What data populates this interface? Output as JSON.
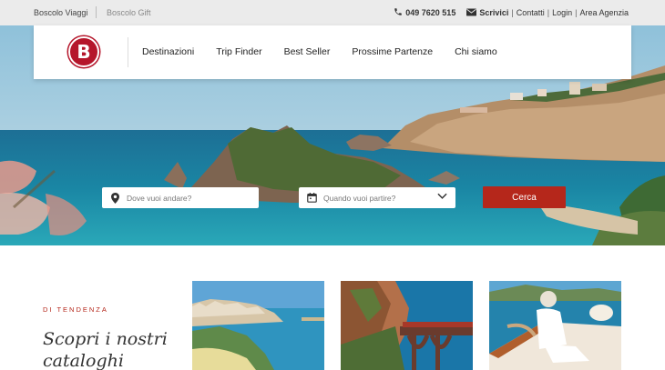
{
  "topbar": {
    "link1": "Boscolo Viaggi",
    "link2": "Boscolo Gift",
    "phone": "049 7620 515",
    "write": "Scrivici",
    "contacts": "Contatti",
    "login": "Login",
    "agency": "Area Agenzia",
    "pipe": "|"
  },
  "logo": {
    "letter": "B"
  },
  "nav": {
    "items": [
      "Destinazioni",
      "Trip Finder",
      "Best Seller",
      "Prossime Partenze",
      "Chi siamo"
    ]
  },
  "search": {
    "where_placeholder": "Dove vuoi andare?",
    "when_placeholder": "Quando vuoi partire?",
    "button": "Cerca"
  },
  "section": {
    "kicker": "DI TENDENZA",
    "title": "Scopri i nostri cataloghi"
  },
  "colors": {
    "brand": "#b5162b",
    "button": "#b5271b"
  }
}
